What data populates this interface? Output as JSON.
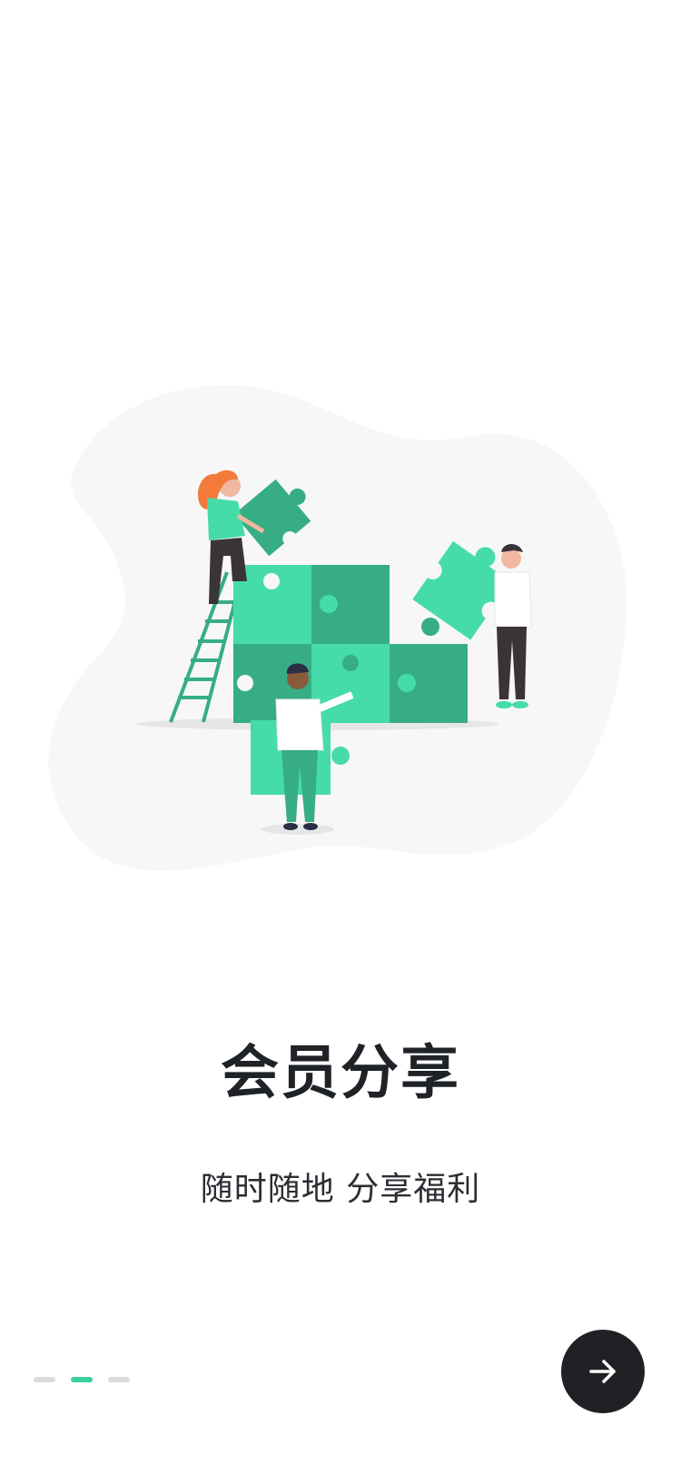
{
  "onboarding": {
    "title": "会员分享",
    "subtitle": "随时随地 分享福利",
    "page_indicator": {
      "total": 3,
      "active_index": 1
    },
    "next_button": {
      "icon": "arrow-right-icon"
    },
    "illustration": {
      "subject": "people-assembling-puzzle"
    }
  },
  "colors": {
    "accent": "#3ecf9f",
    "puzzle_light": "#45dca9",
    "puzzle_dark": "#36ad85",
    "button_bg": "#1f2124",
    "blob_bg": "#f7f7f7",
    "title_text": "#1f2226"
  }
}
